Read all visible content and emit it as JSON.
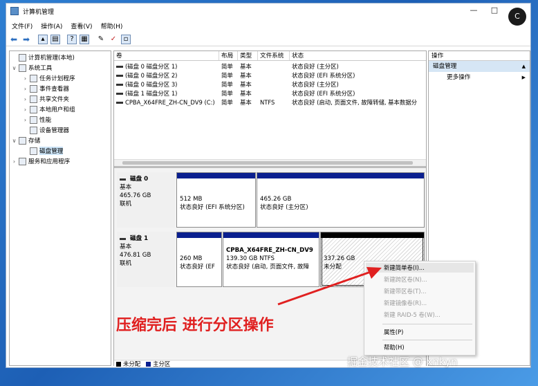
{
  "window": {
    "title": "计算机管理",
    "avatar": "C"
  },
  "menu": [
    "文件(F)",
    "操作(A)",
    "查看(V)",
    "帮助(H)"
  ],
  "tree": {
    "root": "计算机管理(本地)",
    "system_tools": "系统工具",
    "task_scheduler": "任务计划程序",
    "event_viewer": "事件查看器",
    "shared_folders": "共享文件夹",
    "local_users": "本地用户和组",
    "performance": "性能",
    "device_manager": "设备管理器",
    "storage": "存储",
    "disk_mgmt": "磁盘管理",
    "services": "服务和应用程序"
  },
  "volumes": {
    "headers": [
      "卷",
      "布局",
      "类型",
      "文件系统",
      "状态"
    ],
    "rows": [
      [
        "(磁盘 0 磁盘分区 1)",
        "简单",
        "基本",
        "",
        "状态良好 (主分区)"
      ],
      [
        "(磁盘 0 磁盘分区 2)",
        "简单",
        "基本",
        "",
        "状态良好 (EFI 系统分区)"
      ],
      [
        "(磁盘 0 磁盘分区 3)",
        "简单",
        "基本",
        "",
        "状态良好 (主分区)"
      ],
      [
        "(磁盘 1 磁盘分区 1)",
        "简单",
        "基本",
        "",
        "状态良好 (EFI 系统分区)"
      ],
      [
        "CPBA_X64FRE_ZH-CN_DV9 (C:)",
        "简单",
        "基本",
        "NTFS",
        "状态良好 (启动, 页面文件, 故障转储, 基本数据分"
      ]
    ]
  },
  "disks": [
    {
      "name": "磁盘 0",
      "type": "基本",
      "size": "465.76 GB",
      "status": "联机",
      "parts": [
        {
          "size": "512 MB",
          "status": "状态良好 (EFI 系统分区)"
        },
        {
          "size": "465.26 GB",
          "status": "状态良好 (主分区)"
        }
      ]
    },
    {
      "name": "磁盘 1",
      "type": "基本",
      "size": "476.81 GB",
      "status": "联机",
      "parts": [
        {
          "size": "260 MB",
          "status": "状态良好 (EF"
        },
        {
          "name": "CPBA_X64FRE_ZH-CN_DV9",
          "size": "139.30 GB NTFS",
          "status": "状态良好 (启动, 页面文件, 故障"
        },
        {
          "size": "337.26 GB",
          "status": "未分配"
        }
      ]
    }
  ],
  "legend": {
    "unallocated": "未分配",
    "primary": "主分区"
  },
  "ops": {
    "header": "操作",
    "section": "磁盘管理",
    "more": "更多操作"
  },
  "context_menu": {
    "new_simple": "新建简单卷(I)...",
    "new_spanned": "新建跨区卷(N)...",
    "new_striped": "新建带区卷(T)...",
    "new_mirror": "新建镜像卷(R)...",
    "new_raid5": "新建 RAID-5 卷(W)...",
    "properties": "属性(P)",
    "help": "帮助(H)"
  },
  "annotation": "压缩完后 进行分区操作",
  "watermark": "掘金技术社区 @ xnkyn",
  "colors": {
    "primary": "#0a1f8f",
    "unallocated": "#000000",
    "arrow": "#e02020"
  }
}
